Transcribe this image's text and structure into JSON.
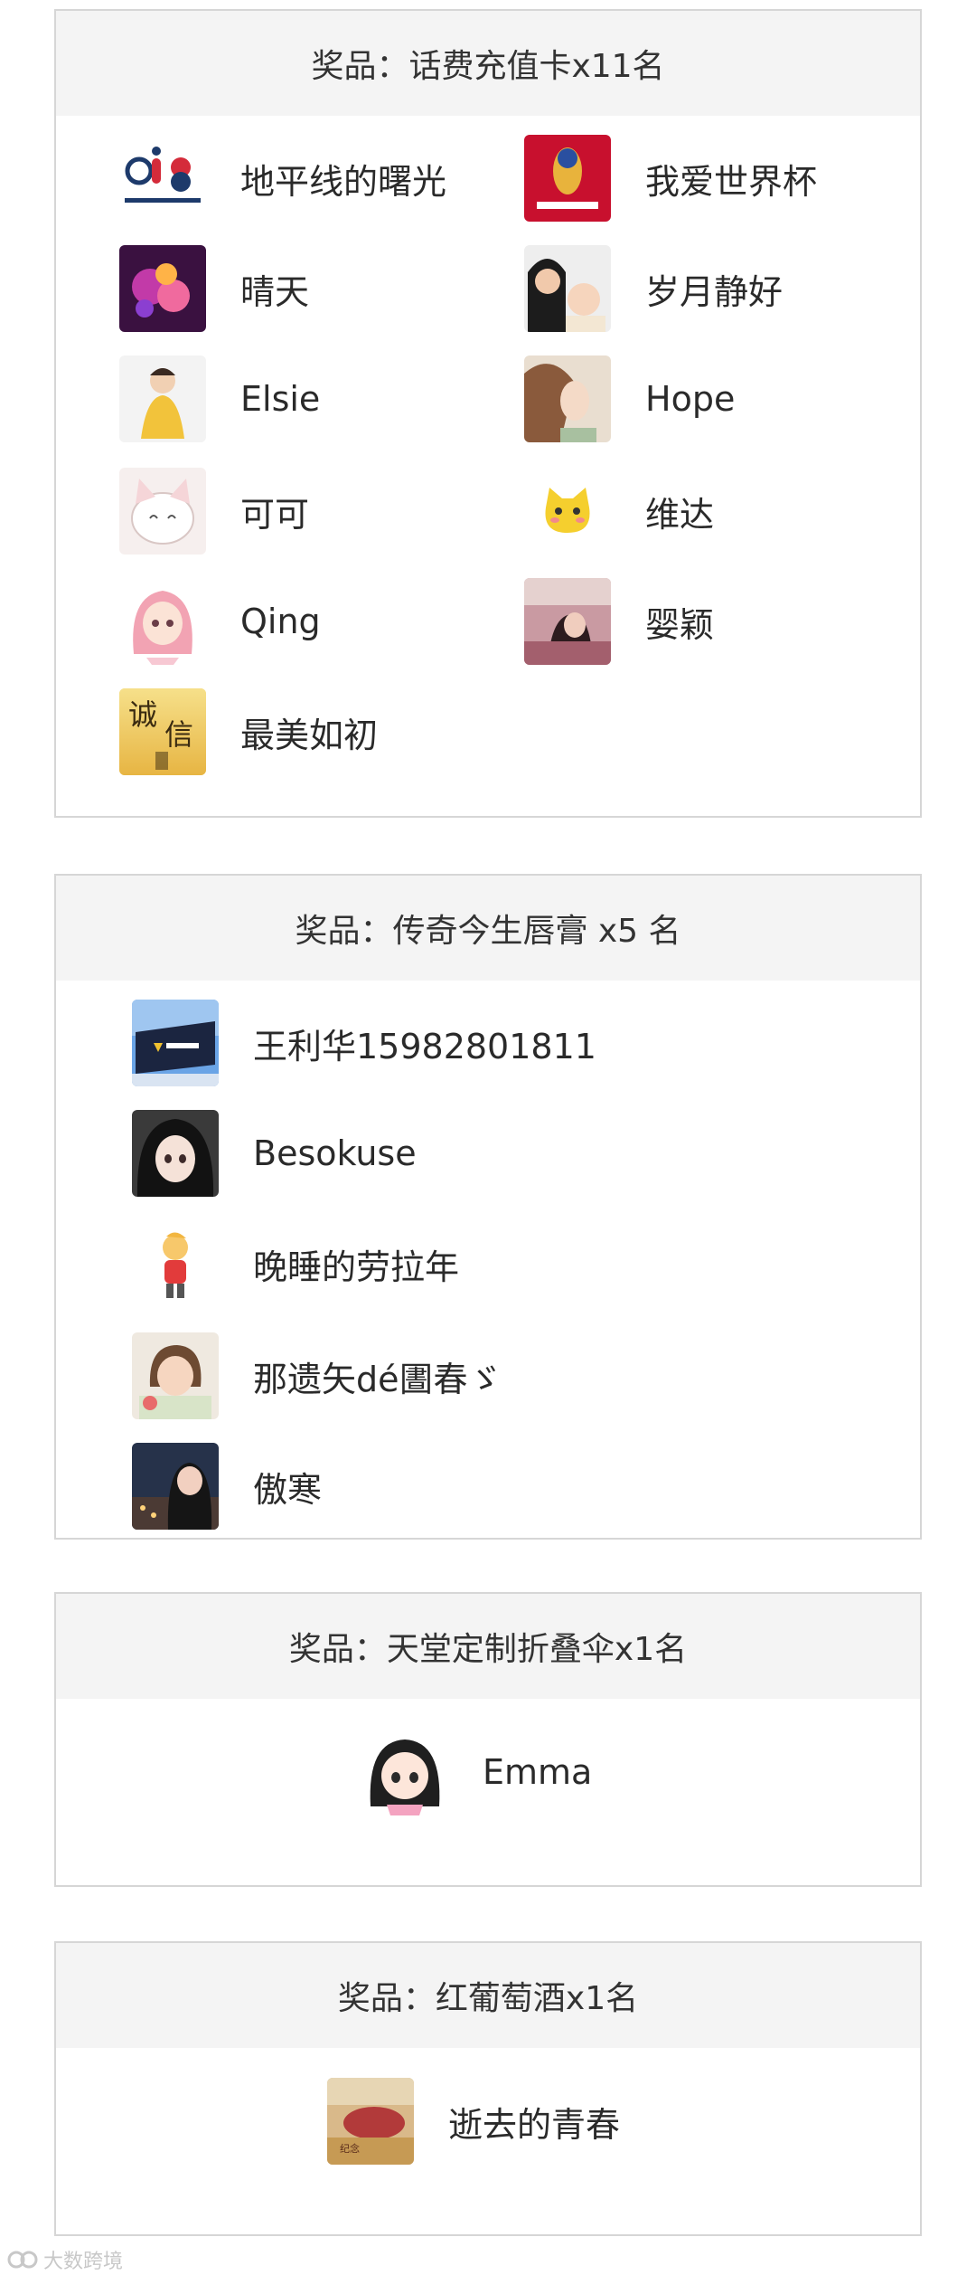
{
  "cards": [
    {
      "title": "奖品：话费充值卡x11名",
      "winners": [
        {
          "name": "地平线的曙光",
          "avatar": "mighty-dream-logo-avatar"
        },
        {
          "name": "我爱世界杯",
          "avatar": "world-cup-russia-avatar"
        },
        {
          "name": "晴天",
          "avatar": "purple-flowers-avatar"
        },
        {
          "name": "岁月静好",
          "avatar": "mother-and-baby-avatar"
        },
        {
          "name": "Elsie",
          "avatar": "girl-in-yellow-avatar"
        },
        {
          "name": "Hope",
          "avatar": "illustrated-girl-avatar"
        },
        {
          "name": "可可",
          "avatar": "white-cat-cartoon-avatar"
        },
        {
          "name": "维达",
          "avatar": "yellow-cat-emoji-avatar"
        },
        {
          "name": "Qing",
          "avatar": "pink-hair-girl-avatar"
        },
        {
          "name": "婴颖",
          "avatar": "woman-photo-avatar"
        },
        {
          "name": "最美如初",
          "avatar": "chengxin-calligraphy-avatar"
        }
      ]
    },
    {
      "title": "奖品：传奇今生唇膏 x5 名",
      "winners": [
        {
          "name": "王利华15982801811",
          "avatar": "building-sign-avatar"
        },
        {
          "name": "Besokuse",
          "avatar": "anime-girl-avatar"
        },
        {
          "name": "晚睡的劳拉年",
          "avatar": "cartoon-figure-avatar"
        },
        {
          "name": "那遗矢dé圕春ゞ",
          "avatar": "little-girl-avatar"
        },
        {
          "name": "傲寒",
          "avatar": "woman-city-avatar"
        }
      ]
    },
    {
      "title": "奖品：天堂定制折叠伞x1名",
      "winners": [
        {
          "name": "Emma",
          "avatar": "chibi-girl-avatar"
        }
      ]
    },
    {
      "title": "奖品：红葡萄酒x1名",
      "winners": [
        {
          "name": "逝去的青春",
          "avatar": "food-photo-avatar"
        }
      ]
    }
  ],
  "watermark": "大数跨境"
}
